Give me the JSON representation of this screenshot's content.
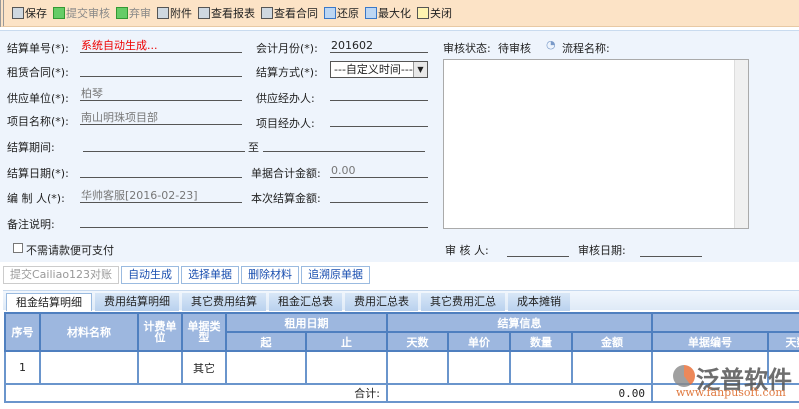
{
  "toolbar": {
    "items": [
      {
        "label": "保存",
        "icon": "save-icon"
      },
      {
        "label": "提交审核",
        "icon": "submit-icon"
      },
      {
        "label": "弃审",
        "icon": "unapprove-icon"
      },
      {
        "label": "附件",
        "icon": "attachment-icon"
      },
      {
        "label": "查看报表",
        "icon": "report-icon"
      },
      {
        "label": "查看合同",
        "icon": "contract-icon"
      },
      {
        "label": "还原",
        "icon": "restore-icon"
      },
      {
        "label": "最大化",
        "icon": "maximize-icon"
      },
      {
        "label": "关闭",
        "icon": "close-icon"
      }
    ]
  },
  "form": {
    "settle_no_label": "结算单号(*):",
    "settle_no": "系统自动生成...",
    "month_label": "会计月份(*):",
    "month": "201602",
    "contract_label": "租赁合同(*):",
    "contract": "",
    "method_label": "结算方式(*):",
    "method": "---自定义时间---",
    "supplier_label": "供应单位(*):",
    "supplier": "柏琴",
    "supplier_agent_label": "供应经办人:",
    "project_label": "项目名称(*):",
    "project": "南山明珠项目部",
    "project_agent_label": "项目经办人:",
    "period_label": "结算期间:",
    "period_to": "至",
    "date_label": "结算日期(*):",
    "total_label": "单据合计金额:",
    "total": "0.00",
    "maker_label": "编 制 人(*):",
    "maker": "华帅客服[2016-02-23]",
    "this_amount_label": "本次结算金额:",
    "remark_label": "备注说明:",
    "no_request_label": "不需请款便可支付",
    "audit_status_label": "审核状态:",
    "audit_status": "待审核",
    "flow_label": "流程名称:",
    "auditor_label": "审 核 人:",
    "audit_date_label": "审核日期:"
  },
  "actions": [
    "提交Cailiao123对账",
    "自动生成",
    "选择单据",
    "删除材料",
    "追溯原单据"
  ],
  "tabs": [
    "租金结算明细",
    "费用结算明细",
    "其它费用结算",
    "租金汇总表",
    "费用汇总表",
    "其它费用汇总",
    "成本摊销"
  ],
  "table": {
    "h": {
      "seq": "序号",
      "name": "材料名称",
      "unit": "计费单位",
      "type": "单据类型",
      "rent_date": "租用日期",
      "start": "起",
      "end": "止",
      "settle": "结算信息",
      "days": "天数",
      "price": "单价",
      "qty": "数量",
      "amount": "金额",
      "doc_no": "单据编号",
      "days2": "天数"
    },
    "row": {
      "seq": "1",
      "type": "其它"
    },
    "total_label": "合计:",
    "total": "0.00"
  },
  "logo": {
    "name": "泛普软件",
    "url": "www.fanpusoft.com"
  }
}
